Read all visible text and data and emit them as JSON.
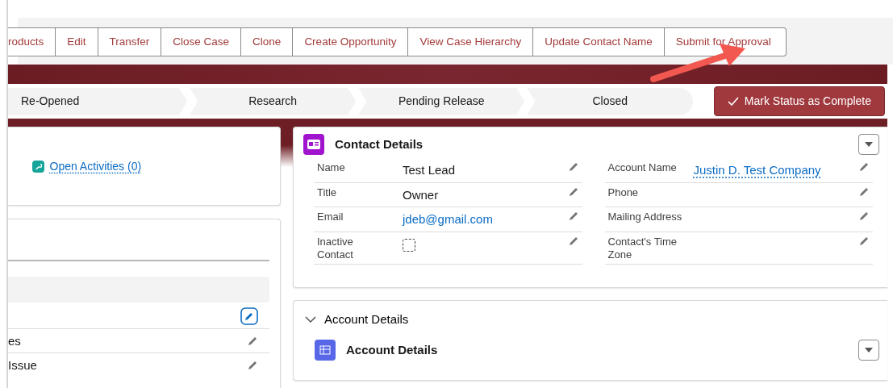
{
  "actions": [
    "roducts",
    "Edit",
    "Transfer",
    "Close Case",
    "Clone",
    "Create Opportunity",
    "View Case Hierarchy",
    "Update Contact Name",
    "Submit for Approval"
  ],
  "path": {
    "stages": [
      {
        "label": "Re-Opened",
        "selected": false
      },
      {
        "label": "Research",
        "selected": false
      },
      {
        "label": "Pending Release",
        "selected": false
      },
      {
        "label": "Closed",
        "selected": false
      }
    ],
    "complete_button": "Mark Status as Complete"
  },
  "activities_link": "Open Activities (0)",
  "left_fields": [
    "es",
    "Issue"
  ],
  "contact_details": {
    "title": "Contact Details",
    "fields": [
      {
        "label": "Name",
        "value": "Test Lead",
        "kind": "text"
      },
      {
        "label": "Account Name",
        "value": "Justin D. Test Company",
        "kind": "link"
      },
      {
        "label": "Title",
        "value": "Owner",
        "kind": "text"
      },
      {
        "label": "Phone",
        "kind": "text"
      },
      {
        "label": "Email",
        "value": "jdeb@gmail.com",
        "kind": "email"
      },
      {
        "label": "Mailing Address",
        "kind": "text"
      },
      {
        "label": "Inactive Contact",
        "kind": "checkbox",
        "checked": false
      },
      {
        "label": "Contact's Time Zone",
        "kind": "text"
      }
    ]
  },
  "account_section": {
    "title": "Account Details",
    "expanded": true,
    "card_title": "Account Details"
  }
}
